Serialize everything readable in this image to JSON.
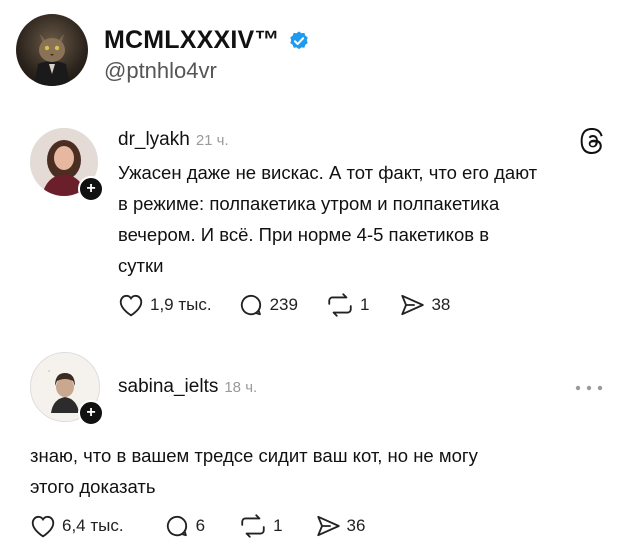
{
  "repost_author": {
    "name": "MCMLXXXIV™",
    "handle": "@ptnhlo4vr"
  },
  "post": {
    "username": "dr_lyakh",
    "time": "21 ч.",
    "text_lines": [
      "Ужасен даже не вискас. А тот факт, что его дают",
      "в режиме: полпакетика утром и полпакетика",
      "вечером. И всё.  При норме 4-5 пакетиков в",
      "сутки"
    ],
    "likes": "1,9 тыс.",
    "comments": "239",
    "reposts": "1",
    "shares": "38"
  },
  "reply": {
    "username": "sabina_ielts",
    "time": "18 ч.",
    "text_lines": [
      "знаю, что в вашем тредсе сидит ваш кот, но не могу",
      "этого доказать"
    ],
    "likes": "6,4 тыс.",
    "comments": "6",
    "reposts": "1",
    "shares": "36"
  },
  "colors": {
    "verified_blue": "#1d9bf0",
    "text": "#111111",
    "muted": "#9a9a9a"
  },
  "icons": [
    "verified-badge-icon",
    "threads-logo-icon",
    "heart-icon",
    "comment-icon",
    "repost-icon",
    "share-icon",
    "more-icon",
    "plus-icon"
  ]
}
